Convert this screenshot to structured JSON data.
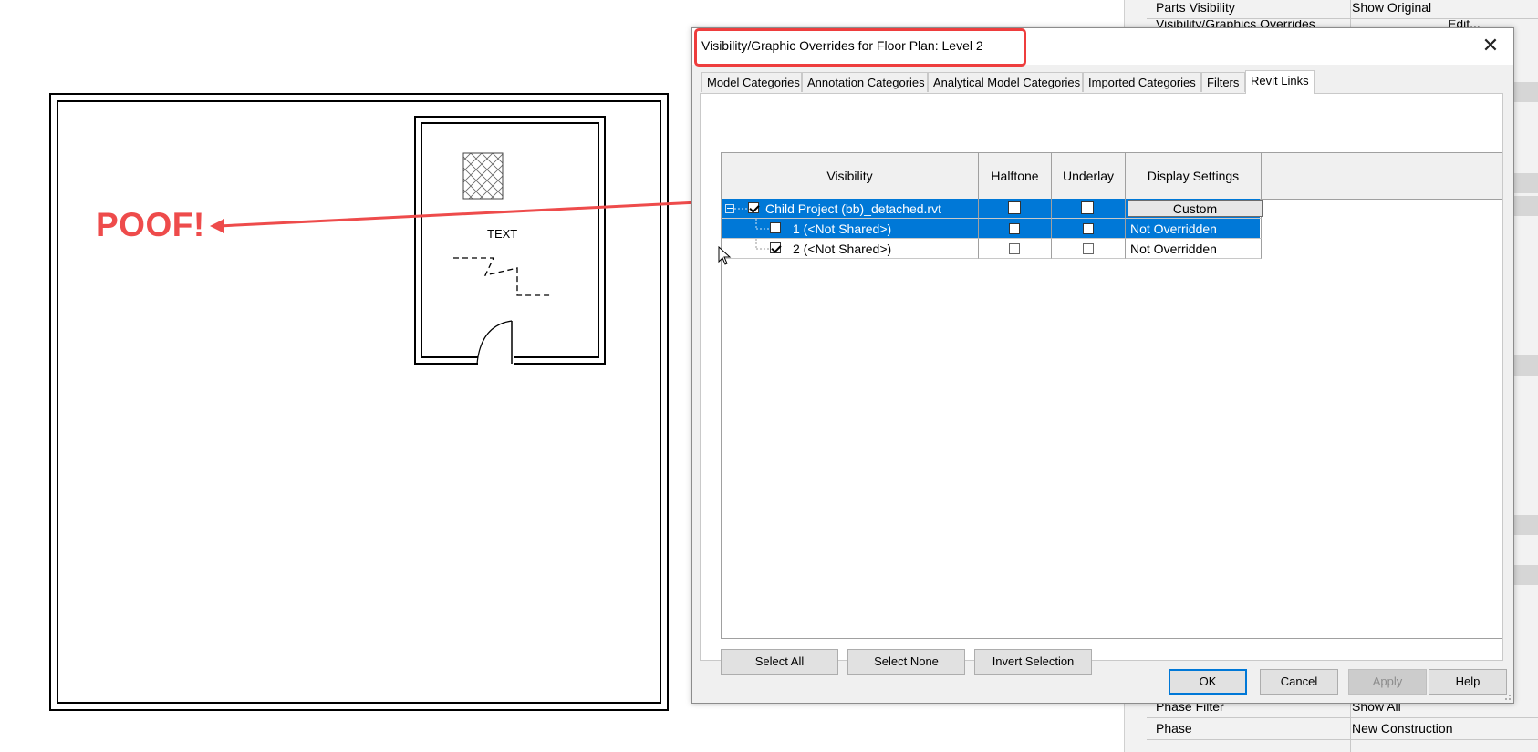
{
  "annotation": {
    "poof_text": "POOF!",
    "highlight_color": "#ee4b4b"
  },
  "drawing": {
    "room_text": "TEXT"
  },
  "properties": {
    "rows_top": [
      {
        "name": "Parts Visibility",
        "value": "Show Original"
      },
      {
        "name": "Visibility/Graphics Overrides",
        "value": "Edit..."
      }
    ],
    "rows_bottom": [
      {
        "name": "Phase Filter",
        "value": "Show All"
      },
      {
        "name": "Phase",
        "value": "New Construction"
      }
    ]
  },
  "dialog": {
    "title": "Visibility/Graphic Overrides for Floor Plan: Level 2",
    "tabs": [
      {
        "label": "Model Categories",
        "active": false
      },
      {
        "label": "Annotation Categories",
        "active": false
      },
      {
        "label": "Analytical Model Categories",
        "active": false
      },
      {
        "label": "Imported Categories",
        "active": false
      },
      {
        "label": "Filters",
        "active": false
      },
      {
        "label": "Revit Links",
        "active": true
      }
    ],
    "grid": {
      "columns": [
        "Visibility",
        "Halftone",
        "Underlay",
        "Display Settings"
      ],
      "rows": [
        {
          "name": "Child Project (bb)_detached.rvt",
          "visible": true,
          "halftone": false,
          "underlay": false,
          "display": "Custom",
          "selected": true
        },
        {
          "name": "1 (<Not Shared>)",
          "visible": false,
          "halftone": false,
          "underlay": false,
          "display": "Not Overridden",
          "selected": true
        },
        {
          "name": "2 (<Not Shared>)",
          "visible": true,
          "halftone": false,
          "underlay": false,
          "display": "Not Overridden",
          "selected": false
        }
      ]
    },
    "buttons": {
      "select_all": "Select All",
      "select_none": "Select None",
      "invert_selection": "Invert Selection",
      "ok": "OK",
      "cancel": "Cancel",
      "apply": "Apply",
      "help": "Help"
    },
    "accent": "#0078d7"
  }
}
